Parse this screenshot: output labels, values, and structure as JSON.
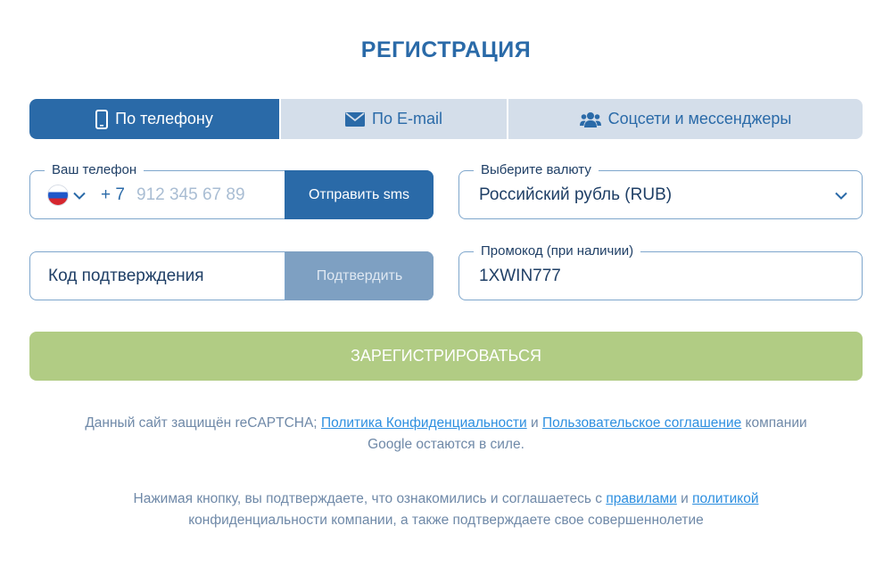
{
  "title": "РЕГИСТРАЦИЯ",
  "tabs": [
    {
      "label": "По телефону",
      "icon": "phone-icon",
      "active": true
    },
    {
      "label": "По E-mail",
      "icon": "envelope-icon",
      "active": false
    },
    {
      "label": "Соцсети и мессенджеры",
      "icon": "users-icon",
      "active": false
    }
  ],
  "phone": {
    "legend": "Ваш телефон",
    "country_code": "+ 7",
    "placeholder": "912 345 67 89",
    "send_sms_label": "Отправить sms"
  },
  "currency": {
    "legend": "Выберите валюту",
    "selected": "Российский рубль (RUB)"
  },
  "code": {
    "placeholder": "Код подтверждения",
    "confirm_label": "Подтвердить"
  },
  "promo": {
    "legend": "Промокод (при наличии)",
    "value": "1XWIN777"
  },
  "register_label": "ЗАРЕГИСТРИРОВАТЬСЯ",
  "recaptcha_note": {
    "prefix": "Данный сайт защищён reCAPTCHA; ",
    "privacy_link": "Политика Конфиденциальности",
    "and": " и ",
    "terms_link": "Пользовательское соглашение",
    "suffix_1": " компании",
    "suffix_2": "Google остаются в силе."
  },
  "consent_note": {
    "prefix": "Нажимая кнопку, вы подтверждаете, что ознакомились и соглашаетесь с ",
    "rules_link": "правилами",
    "and": " и ",
    "policy_link": "политикой",
    "suffix": "конфиденциальности компании, а также подтверждаете свое совершеннолетие"
  },
  "colors": {
    "primary": "#2a6aa8",
    "tab_bg": "#d4deea",
    "register": "#b1cc84",
    "link": "#2d8fe0"
  }
}
